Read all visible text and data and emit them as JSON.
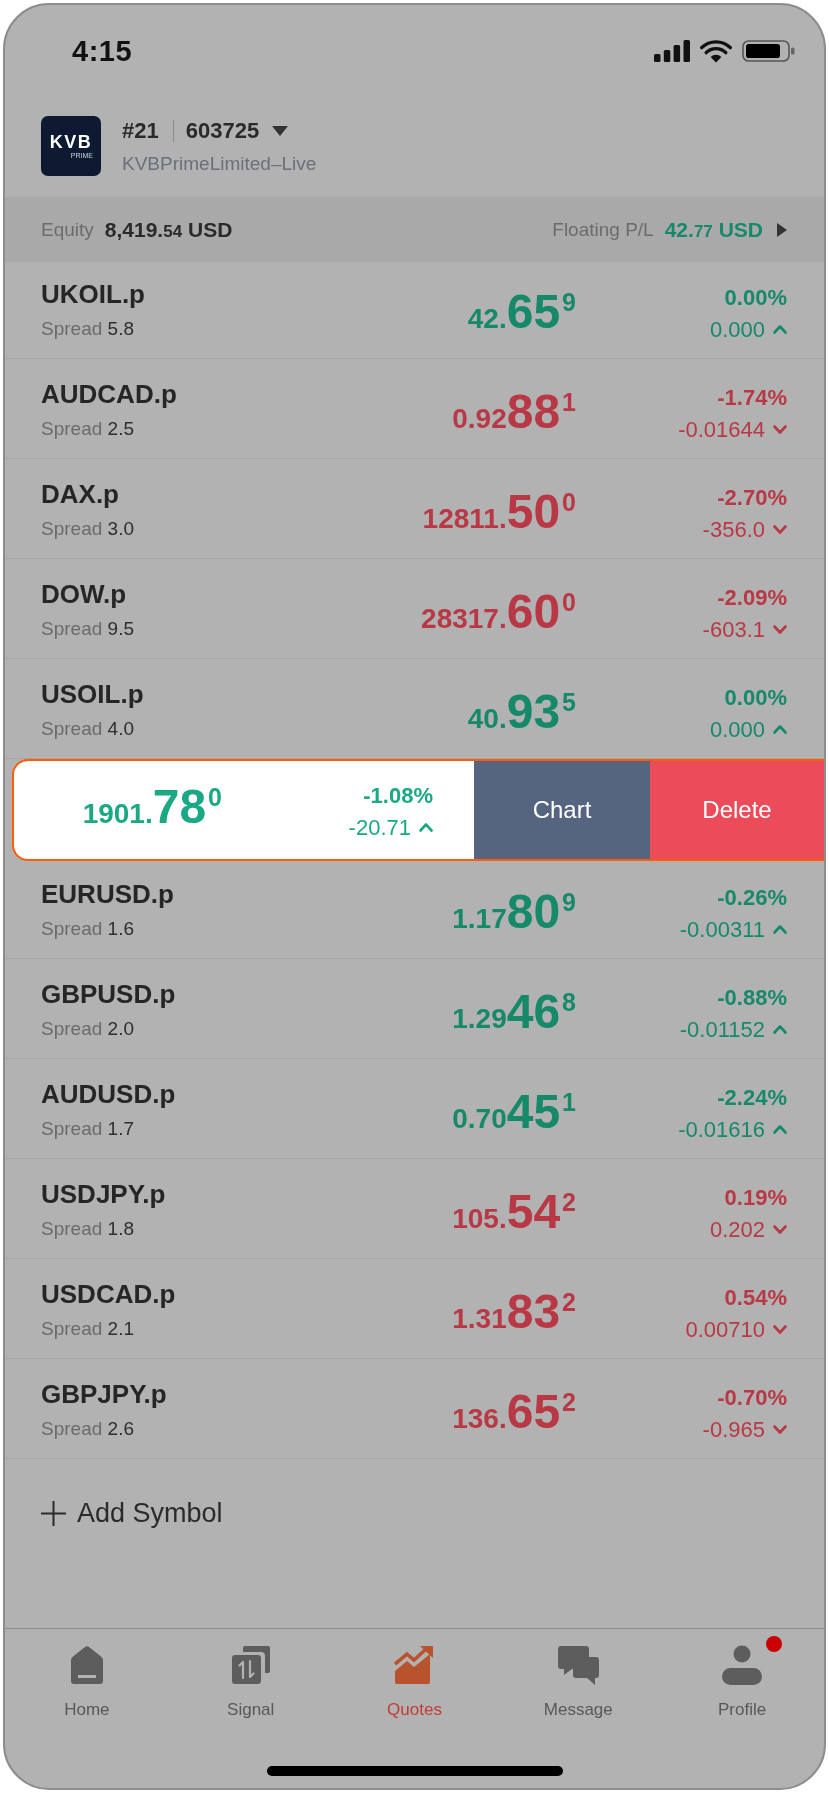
{
  "status_bar": {
    "time": "4:15"
  },
  "account": {
    "logo": {
      "name": "KVB",
      "tagline": "PRIME"
    },
    "number": "#21",
    "login": "603725",
    "server": "KVBPrimeLimited–Live"
  },
  "summary": {
    "equity": {
      "label": "Equity",
      "value": "8,419.",
      "decimals": "54",
      "currency": "USD"
    },
    "floating_pl": {
      "label": "Floating P/L",
      "value": "42.",
      "decimals": "77",
      "currency": "USD",
      "rising": true
    }
  },
  "rows": [
    {
      "kind": "quote",
      "symbol": "UKOIL.p",
      "spread_label": "Spread",
      "spread": "5.8",
      "price_head": "42.",
      "price_big": "65",
      "price_sup": "9",
      "change_percent": "0.00%",
      "change": "0.000",
      "rising": true
    },
    {
      "kind": "quote",
      "symbol": "AUDCAD.p",
      "spread_label": "Spread",
      "spread": "2.5",
      "price_head": "0.92",
      "price_big": "88",
      "price_sup": "1",
      "change_percent": "-1.74%",
      "change": "-0.01644",
      "rising": false
    },
    {
      "kind": "quote",
      "symbol": "DAX.p",
      "spread_label": "Spread",
      "spread": "3.0",
      "price_head": "12811.",
      "price_big": "50",
      "price_sup": "0",
      "change_percent": "-2.70%",
      "change": "-356.0",
      "rising": false
    },
    {
      "kind": "quote",
      "symbol": "DOW.p",
      "spread_label": "Spread",
      "spread": "9.5",
      "price_head": "28317.",
      "price_big": "60",
      "price_sup": "0",
      "change_percent": "-2.09%",
      "change": "-603.1",
      "rising": false
    },
    {
      "kind": "quote",
      "symbol": "USOIL.p",
      "spread_label": "Spread",
      "spread": "4.0",
      "price_head": "40.",
      "price_big": "93",
      "price_sup": "5",
      "change_percent": "0.00%",
      "change": "0.000",
      "rising": true
    },
    {
      "kind": "swiped",
      "price_head": "1901.",
      "price_big": "78",
      "price_sup": "0",
      "change_percent": "-1.08%",
      "change": "-20.71",
      "rising": true,
      "actions": [
        {
          "label": "Chart",
          "kind": "chart"
        },
        {
          "label": "Delete",
          "kind": "delete"
        }
      ]
    },
    {
      "kind": "quote",
      "symbol": "EURUSD.p",
      "spread_label": "Spread",
      "spread": "1.6",
      "price_head": "1.17",
      "price_big": "80",
      "price_sup": "9",
      "change_percent": "-0.26%",
      "change": "-0.00311",
      "rising": true
    },
    {
      "kind": "quote",
      "symbol": "GBPUSD.p",
      "spread_label": "Spread",
      "spread": "2.0",
      "price_head": "1.29",
      "price_big": "46",
      "price_sup": "8",
      "change_percent": "-0.88%",
      "change": "-0.01152",
      "rising": true
    },
    {
      "kind": "quote",
      "symbol": "AUDUSD.p",
      "spread_label": "Spread",
      "spread": "1.7",
      "price_head": "0.70",
      "price_big": "45",
      "price_sup": "1",
      "change_percent": "-2.24%",
      "change": "-0.01616",
      "rising": true
    },
    {
      "kind": "quote",
      "symbol": "USDJPY.p",
      "spread_label": "Spread",
      "spread": "1.8",
      "price_head": "105.",
      "price_big": "54",
      "price_sup": "2",
      "change_percent": "0.19%",
      "change": "0.202",
      "rising": false
    },
    {
      "kind": "quote",
      "symbol": "USDCAD.p",
      "spread_label": "Spread",
      "spread": "2.1",
      "price_head": "1.31",
      "price_big": "83",
      "price_sup": "2",
      "change_percent": "0.54%",
      "change": "0.00710",
      "rising": false
    },
    {
      "kind": "quote",
      "symbol": "GBPJPY.p",
      "spread_label": "Spread",
      "spread": "2.6",
      "price_head": "136.",
      "price_big": "65",
      "price_sup": "2",
      "change_percent": "-0.70%",
      "change": "-0.965",
      "rising": false
    }
  ],
  "add_symbol": {
    "label": "Add Symbol"
  },
  "tab_bar": [
    {
      "label": "Home",
      "kind": "home",
      "selected": false,
      "badge": false
    },
    {
      "label": "Signal",
      "kind": "signal",
      "selected": false,
      "badge": false
    },
    {
      "label": "Quotes",
      "kind": "quotes",
      "selected": true,
      "badge": false
    },
    {
      "label": "Message",
      "kind": "message",
      "selected": false,
      "badge": false
    },
    {
      "label": "Profile",
      "kind": "profile",
      "selected": false,
      "badge": true
    }
  ]
}
